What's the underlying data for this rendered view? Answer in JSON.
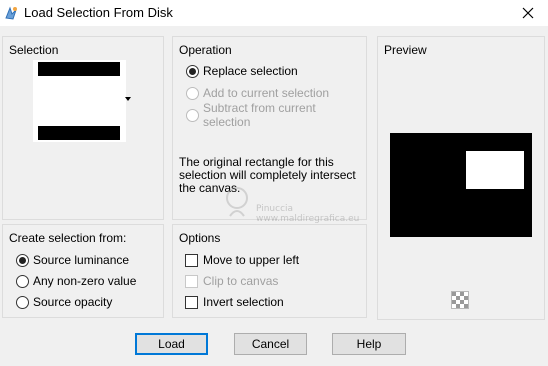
{
  "window": {
    "title": "Load Selection From Disk"
  },
  "selection_group": {
    "title": "Selection"
  },
  "operation_group": {
    "title": "Operation",
    "options": [
      {
        "label": "Replace selection",
        "selected": true,
        "enabled": true
      },
      {
        "label": "Add to current selection",
        "selected": false,
        "enabled": false
      },
      {
        "label": "Subtract from current selection",
        "selected": false,
        "enabled": false
      }
    ],
    "description": "The original rectangle for this selection will completely intersect the canvas."
  },
  "preview_group": {
    "title": "Preview"
  },
  "create_group": {
    "title": "Create selection from:",
    "options": [
      {
        "label": "Source luminance",
        "selected": true
      },
      {
        "label": "Any non-zero value",
        "selected": false
      },
      {
        "label": "Source opacity",
        "selected": false
      }
    ]
  },
  "options_group": {
    "title": "Options",
    "checks": [
      {
        "label": "Move to upper left",
        "checked": false,
        "enabled": true
      },
      {
        "label": "Clip to canvas",
        "checked": false,
        "enabled": false
      },
      {
        "label": "Invert selection",
        "checked": false,
        "enabled": true
      }
    ]
  },
  "buttons": {
    "load": "Load",
    "cancel": "Cancel",
    "help": "Help"
  },
  "watermark": {
    "line1": "Pinuccia",
    "line2": "www.maldiregrafica.eu"
  },
  "colors": {
    "default_button_border": "#0078d7",
    "panel_background": "#f0f0f0"
  }
}
